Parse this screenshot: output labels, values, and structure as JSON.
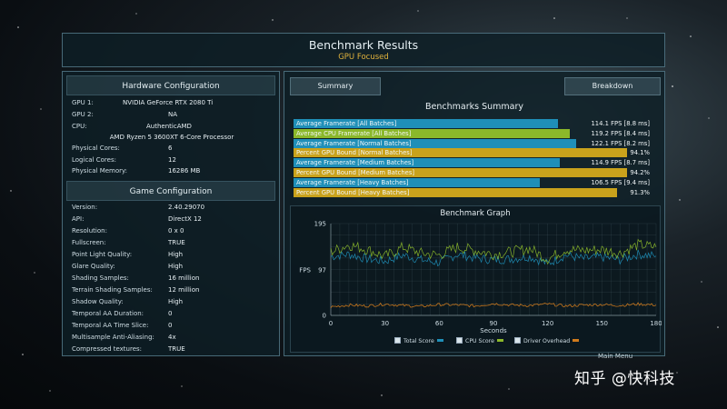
{
  "header": {
    "title": "Benchmark Results",
    "subtitle": "GPU Focused"
  },
  "hardware": {
    "title": "Hardware Configuration",
    "rows": [
      {
        "label": "GPU 1:",
        "value": "NVIDIA GeForce RTX 2080 Ti"
      },
      {
        "label": "GPU 2:",
        "value": "NA"
      },
      {
        "label": "CPU:",
        "value": "AuthenticAMD"
      },
      {
        "label": "",
        "value": "AMD Ryzen 5 3600XT 6-Core Processor"
      },
      {
        "label": "Physical Cores:",
        "value": "6"
      },
      {
        "label": "Logical Cores:",
        "value": "12"
      },
      {
        "label": "Physical Memory:",
        "value": "16286  MB"
      }
    ]
  },
  "game": {
    "title": "Game Configuration",
    "rows": [
      {
        "label": "Version:",
        "value": "2.40.29070"
      },
      {
        "label": "API:",
        "value": "DirectX 12"
      },
      {
        "label": "Resolution:",
        "value": "0 x 0"
      },
      {
        "label": "Fullscreen:",
        "value": "TRUE"
      },
      {
        "label": "Point Light Quality:",
        "value": "High"
      },
      {
        "label": "Glare Quality:",
        "value": "High"
      },
      {
        "label": "Shading Samples:",
        "value": "16 million"
      },
      {
        "label": "Terrain Shading Samples:",
        "value": "12 million"
      },
      {
        "label": "Shadow Quality:",
        "value": "High"
      },
      {
        "label": "Temporal AA Duration:",
        "value": "0"
      },
      {
        "label": "Temporal AA Time Slice:",
        "value": "0"
      },
      {
        "label": "Multisample Anti-Aliasing:",
        "value": "4x"
      },
      {
        "label": "Compressed textures:",
        "value": "TRUE"
      }
    ]
  },
  "tabs": {
    "summary": "Summary",
    "breakdown": "Breakdown"
  },
  "summary": {
    "title": "Benchmarks Summary",
    "bars": [
      {
        "label": "Average Framerate [All Batches]",
        "value": "114.1 FPS [8.8 ms]",
        "fraction": 0.745,
        "color": "#1f8fb8"
      },
      {
        "label": "Average CPU Framerate [All Batches]",
        "value": "119.2 FPS [8.4 ms]",
        "fraction": 0.779,
        "color": "#8bb82a"
      },
      {
        "label": "Average Framerate [Normal Batches]",
        "value": "122.1 FPS [8.2 ms]",
        "fraction": 0.798,
        "color": "#1f8fb8"
      },
      {
        "label": "Percent GPU Bound [Normal Batches]",
        "value": "94.1%",
        "fraction": 0.941,
        "color": "#c9a21c"
      },
      {
        "label": "Average Framerate [Medium Batches]",
        "value": "114.9 FPS [8.7 ms]",
        "fraction": 0.751,
        "color": "#1f8fb8"
      },
      {
        "label": "Percent GPU Bound [Medium Batches]",
        "value": "94.2%",
        "fraction": 0.942,
        "color": "#c9a21c"
      },
      {
        "label": "Average Framerate [Heavy Batches]",
        "value": "106.5 FPS [9.4 ms]",
        "fraction": 0.696,
        "color": "#1f8fb8"
      },
      {
        "label": "Percent GPU Bound [Heavy Batches]",
        "value": "91.3%",
        "fraction": 0.913,
        "color": "#c9a21c"
      }
    ]
  },
  "graph": {
    "title": "Benchmark Graph",
    "y_label": "FPS",
    "y_ticks": [
      "195",
      "97",
      "0"
    ],
    "x_ticks": [
      "0",
      "30",
      "60",
      "90",
      "120",
      "150",
      "180"
    ],
    "x_label": "Seconds",
    "legend": [
      {
        "label": "Total Score",
        "color": "#1f8fb8"
      },
      {
        "label": "CPU Score",
        "color": "#8bb82a"
      },
      {
        "label": "Driver Overhead",
        "color": "#d07a1c"
      }
    ]
  },
  "chart_data": {
    "type": "line",
    "title": "Benchmark Graph",
    "xlabel": "Seconds",
    "ylabel": "FPS",
    "xlim": [
      0,
      180
    ],
    "ylim": [
      0,
      195
    ],
    "grid": true,
    "legend": "bottom",
    "series": [
      {
        "name": "Total Score",
        "x": [
          0,
          10,
          20,
          30,
          40,
          50,
          60,
          70,
          80,
          90,
          100,
          110,
          120,
          130,
          140,
          150,
          160,
          170,
          180
        ],
        "values": [
          125,
          130,
          120,
          115,
          128,
          118,
          112,
          130,
          122,
          118,
          120,
          125,
          110,
          128,
          120,
          124,
          118,
          130,
          126
        ]
      },
      {
        "name": "CPU Score",
        "x": [
          0,
          10,
          20,
          30,
          40,
          50,
          60,
          70,
          80,
          90,
          100,
          110,
          120,
          130,
          140,
          150,
          160,
          170,
          180
        ],
        "values": [
          135,
          150,
          140,
          125,
          145,
          132,
          128,
          145,
          138,
          130,
          135,
          142,
          120,
          140,
          138,
          140,
          132,
          150,
          145
        ]
      },
      {
        "name": "Driver Overhead",
        "x": [
          0,
          10,
          20,
          30,
          40,
          50,
          60,
          70,
          80,
          90,
          100,
          110,
          120,
          130,
          140,
          150,
          160,
          170,
          180
        ],
        "values": [
          18,
          22,
          20,
          24,
          21,
          19,
          23,
          22,
          20,
          25,
          22,
          21,
          24,
          20,
          22,
          23,
          21,
          24,
          22
        ]
      }
    ]
  },
  "footer": {
    "main_menu": "Main Menu"
  },
  "watermark": "知乎 @快科技"
}
